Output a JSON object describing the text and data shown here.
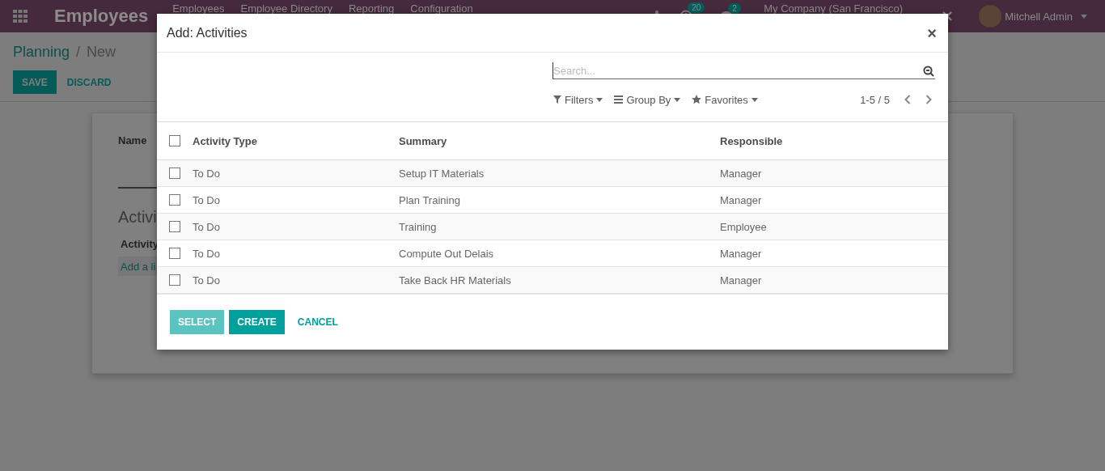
{
  "navbar": {
    "brand": "Employees",
    "menu": [
      "Employees",
      "Employee Directory",
      "Reporting",
      "Configuration"
    ],
    "activity_count": "20",
    "message_count": "2",
    "company": "My Company (San Francisco)",
    "user": "Mitchell Admin"
  },
  "control_panel": {
    "breadcrumb": [
      "Planning",
      "New"
    ],
    "separator": "/",
    "buttons": [
      {
        "label": "SAVE",
        "kind": "primary"
      },
      {
        "label": "DISCARD",
        "kind": "link"
      }
    ]
  },
  "form": {
    "name_label": "Name",
    "section_title": "Activi",
    "column": "Activity",
    "add_link": "Add a li"
  },
  "dialog": {
    "title": "Add: Activities",
    "close": "×",
    "search": {
      "placeholder": "Search..."
    },
    "filters": [
      "Filters",
      "Group By",
      "Favorites"
    ],
    "pager": "1-5 / 5",
    "header_checked": false,
    "columns": [
      "Activity Type",
      "Summary",
      "Responsible"
    ],
    "rows": [
      {
        "activity_type": "To Do",
        "summary": "Setup IT Materials",
        "responsible": "Manager",
        "checked": false
      },
      {
        "activity_type": "To Do",
        "summary": "Plan Training",
        "responsible": "Manager",
        "checked": false
      },
      {
        "activity_type": "To Do",
        "summary": "Training",
        "responsible": "Employee",
        "checked": false
      },
      {
        "activity_type": "To Do",
        "summary": "Compute Out Delais",
        "responsible": "Manager",
        "checked": false
      },
      {
        "activity_type": "To Do",
        "summary": "Take Back HR Materials",
        "responsible": "Manager",
        "checked": false
      }
    ],
    "buttons": [
      {
        "label": "SELECT",
        "kind": "primary",
        "disabled": true
      },
      {
        "label": "CREATE",
        "kind": "primary",
        "disabled": false
      },
      {
        "label": "CANCEL",
        "kind": "link",
        "disabled": false
      }
    ]
  }
}
